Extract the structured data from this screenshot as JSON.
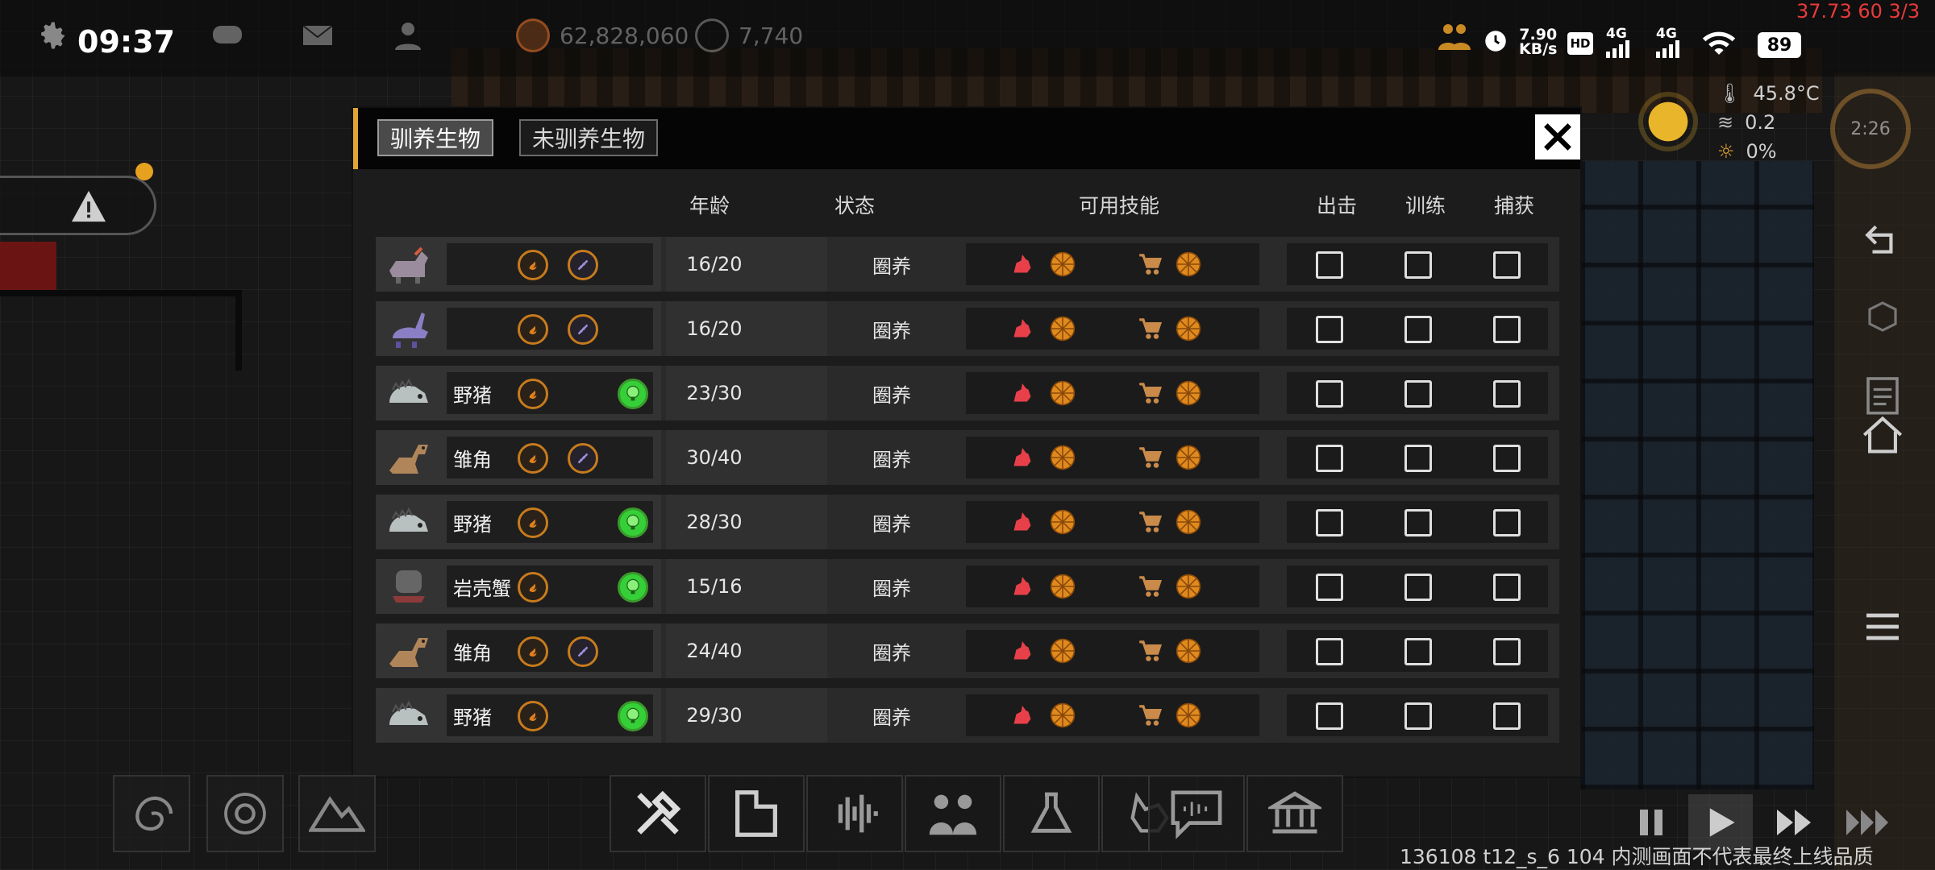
{
  "status_bar": {
    "time": "09:37",
    "resources": [
      {
        "icon": "coin-icon",
        "value": "62,828,060"
      },
      {
        "icon": "science-icon",
        "value": "7,740"
      }
    ],
    "net_speed": "7.90\nKB/s",
    "network_labels": [
      "HD",
      "4G",
      "4G"
    ],
    "battery": "89",
    "fps_overlay": "37.73 60 3/3"
  },
  "weather": {
    "temperature": "45.8°C",
    "wind": "0.2",
    "precipitation": "0%",
    "clock": "2:26"
  },
  "panel": {
    "tabs": [
      {
        "label": "驯养生物",
        "active": true
      },
      {
        "label": "未驯养生物",
        "active": false
      }
    ],
    "columns": {
      "age": "年龄",
      "state": "状态",
      "skills": "可用技能",
      "deploy": "出击",
      "train": "训练",
      "capture": "捕获"
    },
    "rows": [
      {
        "portrait": "rhino-creature",
        "name": "",
        "traits": [
          "orange",
          "violet"
        ],
        "age": "16/20",
        "state": "圈养"
      },
      {
        "portrait": "rabbit-creature",
        "name": "",
        "traits": [
          "orange",
          "violet"
        ],
        "age": "16/20",
        "state": "圈养"
      },
      {
        "portrait": "boar-creature",
        "name": "野猪",
        "traits": [
          "orange",
          "green"
        ],
        "age": "23/30",
        "state": "圈养"
      },
      {
        "portrait": "dino-creature",
        "name": "雏角",
        "traits": [
          "orange",
          "violet"
        ],
        "age": "30/40",
        "state": "圈养"
      },
      {
        "portrait": "boar-creature",
        "name": "野猪",
        "traits": [
          "orange",
          "green"
        ],
        "age": "28/30",
        "state": "圈养"
      },
      {
        "portrait": "crab-creature",
        "name": "岩壳蟹",
        "traits": [
          "orange",
          "green"
        ],
        "age": "15/16",
        "state": "圈养"
      },
      {
        "portrait": "dino-creature",
        "name": "雏角",
        "traits": [
          "orange",
          "violet"
        ],
        "age": "24/40",
        "state": "圈养"
      },
      {
        "portrait": "boar-creature",
        "name": "野猪",
        "traits": [
          "orange",
          "green"
        ],
        "age": "29/30",
        "state": "圈养"
      }
    ]
  },
  "footer": {
    "build_info": "136108 t12_s_6 104 内测画面不代表最终上线品质"
  },
  "colors": {
    "accent": "#e0a533",
    "skill_red": "#e8404a",
    "skill_orange": "#e08a1e",
    "checkbox": "#e0e0e0"
  }
}
